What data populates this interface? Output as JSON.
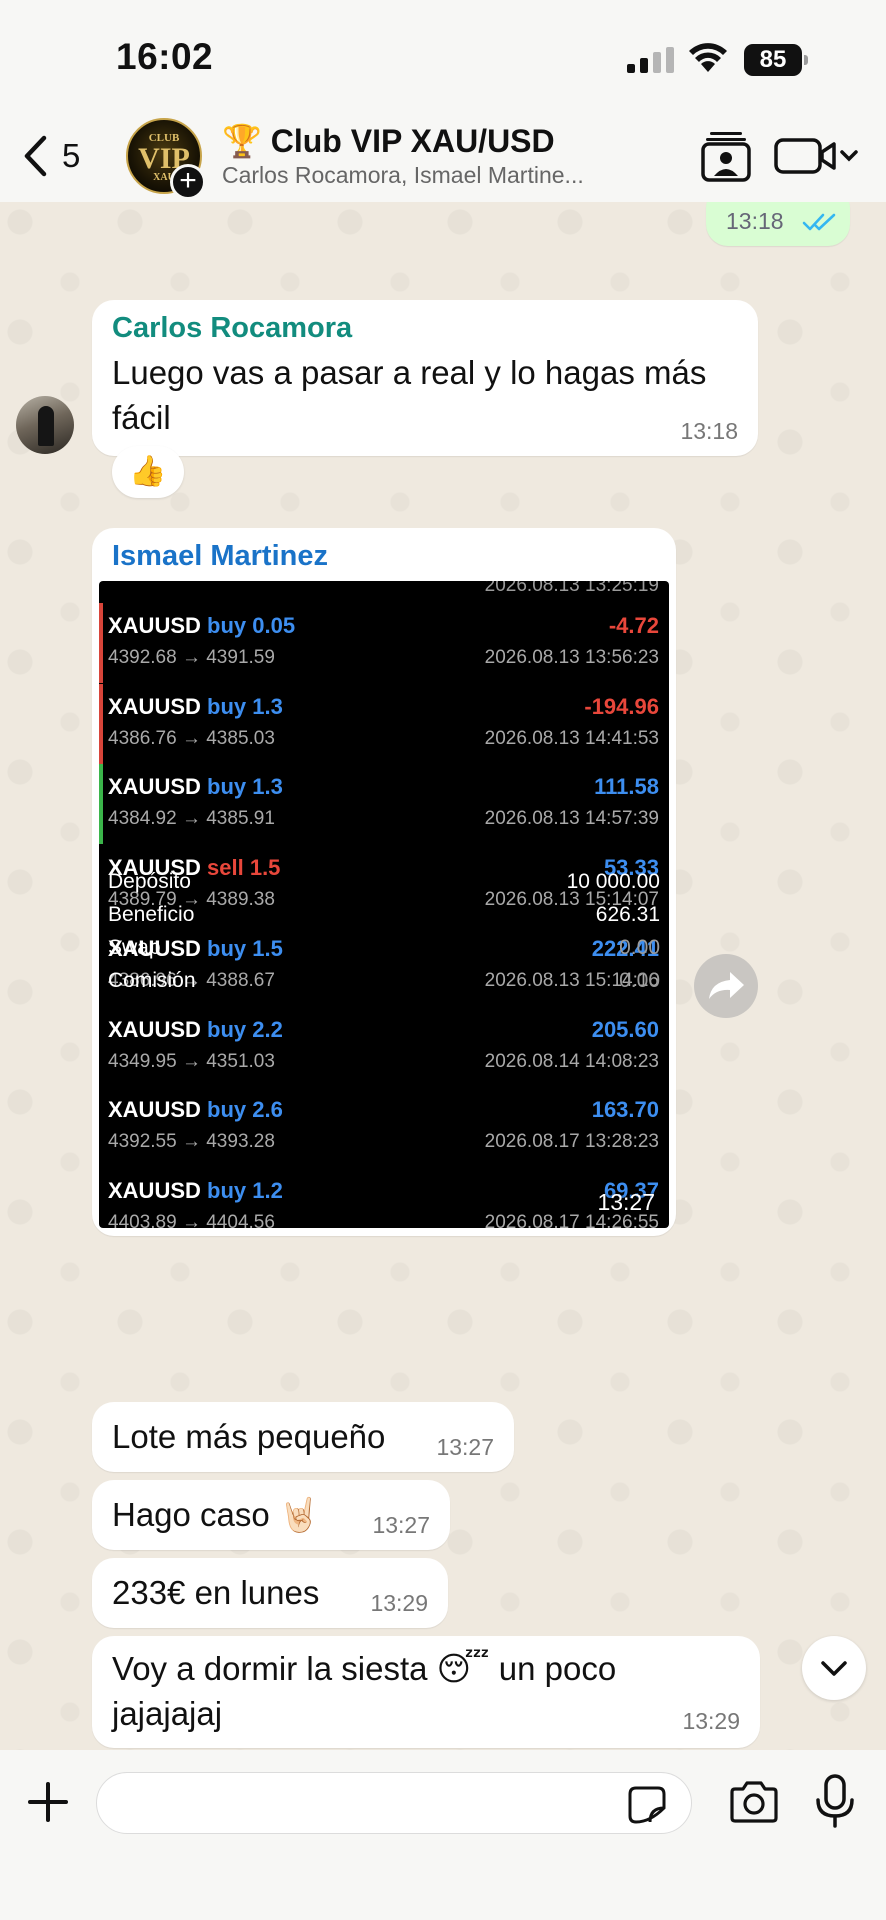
{
  "status_bar": {
    "time": "16:02",
    "battery": "85"
  },
  "header": {
    "back_count": "5",
    "title": "🏆 Club VIP XAU/USD",
    "subtitle": "Carlos Rocamora, Ismael Martine...",
    "avatar_text": [
      "CLUB",
      "VIP",
      "XAU"
    ]
  },
  "messages": {
    "outgoing_time": "13:18",
    "m1": {
      "sender": "Carlos Rocamora",
      "text": "Luego vas a pasar a real y lo hagas más fácil",
      "time": "13:18",
      "reaction": "👍"
    },
    "m2": {
      "sender": "Ismael Martinez",
      "time": "13:27"
    },
    "m3": {
      "text": "Lote más pequeño",
      "time": "13:27"
    },
    "m4": {
      "text": "Hago caso 🤘🏻",
      "time": "13:27"
    },
    "m5": {
      "text": "233€ en lunes",
      "time": "13:29"
    },
    "m6": {
      "text": "Voy a dormir la siesta 😴 un poco jajajajaj",
      "time": "13:29"
    }
  },
  "screenshot": {
    "top_date": "2026.08.13 13:25:19",
    "trades": [
      {
        "symbol": "XAUUSD",
        "side": "buy 0.05",
        "prices": "4392.68 → 4391.59",
        "profit": "-4.72",
        "date": "2026.08.13 13:56:23",
        "side_color": "#3d8ef0",
        "profit_color": "#e8473b",
        "bar_color": "#d8453a"
      },
      {
        "symbol": "XAUUSD",
        "side": "buy 1.3",
        "prices": "4386.76 → 4385.03",
        "profit": "-194.96",
        "date": "2026.08.13 14:41:53",
        "side_color": "#3d8ef0",
        "profit_color": "#e8473b",
        "bar_color": "#d8453a"
      },
      {
        "symbol": "XAUUSD",
        "side": "buy 1.3",
        "prices": "4384.92 → 4385.91",
        "profit": "111.58",
        "date": "2026.08.13 14:57:39",
        "side_color": "#3d8ef0",
        "profit_color": "#3d8ef0",
        "bar_color": "#3bb54a"
      },
      {
        "symbol": "XAUUSD",
        "side": "sell 1.5",
        "prices": "4389.79 → 4389.38",
        "profit": "53.33",
        "date": "2026.08.13 15:14:07",
        "side_color": "#e8473b",
        "profit_color": "#3d8ef0",
        "bar_color": ""
      },
      {
        "symbol": "XAUUSD",
        "side": "buy 1.5",
        "prices": "4386.96 → 4388.67",
        "profit": "222.41",
        "date": "2026.08.13 15:14:16",
        "side_color": "#3d8ef0",
        "profit_color": "#3d8ef0",
        "bar_color": ""
      },
      {
        "symbol": "XAUUSD",
        "side": "buy 2.2",
        "prices": "4349.95 → 4351.03",
        "profit": "205.60",
        "date": "2026.08.14 14:08:23",
        "side_color": "#3d8ef0",
        "profit_color": "#3d8ef0",
        "bar_color": ""
      },
      {
        "symbol": "XAUUSD",
        "side": "buy 2.6",
        "prices": "4392.55 → 4393.28",
        "profit": "163.70",
        "date": "2026.08.17 13:28:23",
        "side_color": "#3d8ef0",
        "profit_color": "#3d8ef0",
        "bar_color": ""
      },
      {
        "symbol": "XAUUSD",
        "side": "buy 1.2",
        "prices": "4403.89 → 4404.56",
        "profit": "69.37",
        "date": "2026.08.17 14:26:55",
        "side_color": "#3d8ef0",
        "profit_color": "#3d8ef0",
        "bar_color": ""
      }
    ],
    "summary": [
      {
        "label": "Depósito",
        "value": "10 000.00"
      },
      {
        "label": "Beneficio",
        "value": "626.31"
      },
      {
        "label": "Swap",
        "value": "0.00"
      },
      {
        "label": "Comisión",
        "value": "0.00"
      }
    ]
  },
  "composer": {
    "placeholder": ""
  },
  "icons": {
    "back": "chevron-left-icon",
    "contact": "contact-card-icon",
    "video": "video-camera-icon",
    "forward": "forward-icon",
    "scroll_down": "chevron-down-icon",
    "plus": "plus-icon",
    "sticker": "sticker-icon",
    "camera": "camera-icon",
    "mic": "microphone-icon",
    "read_receipt": "double-check-icon"
  },
  "colors": {
    "sender_carlos": "#128c7e",
    "sender_ismael": "#1a73c8",
    "read_check": "#34b7f1",
    "outgoing_bubble": "#d9fdd3"
  }
}
